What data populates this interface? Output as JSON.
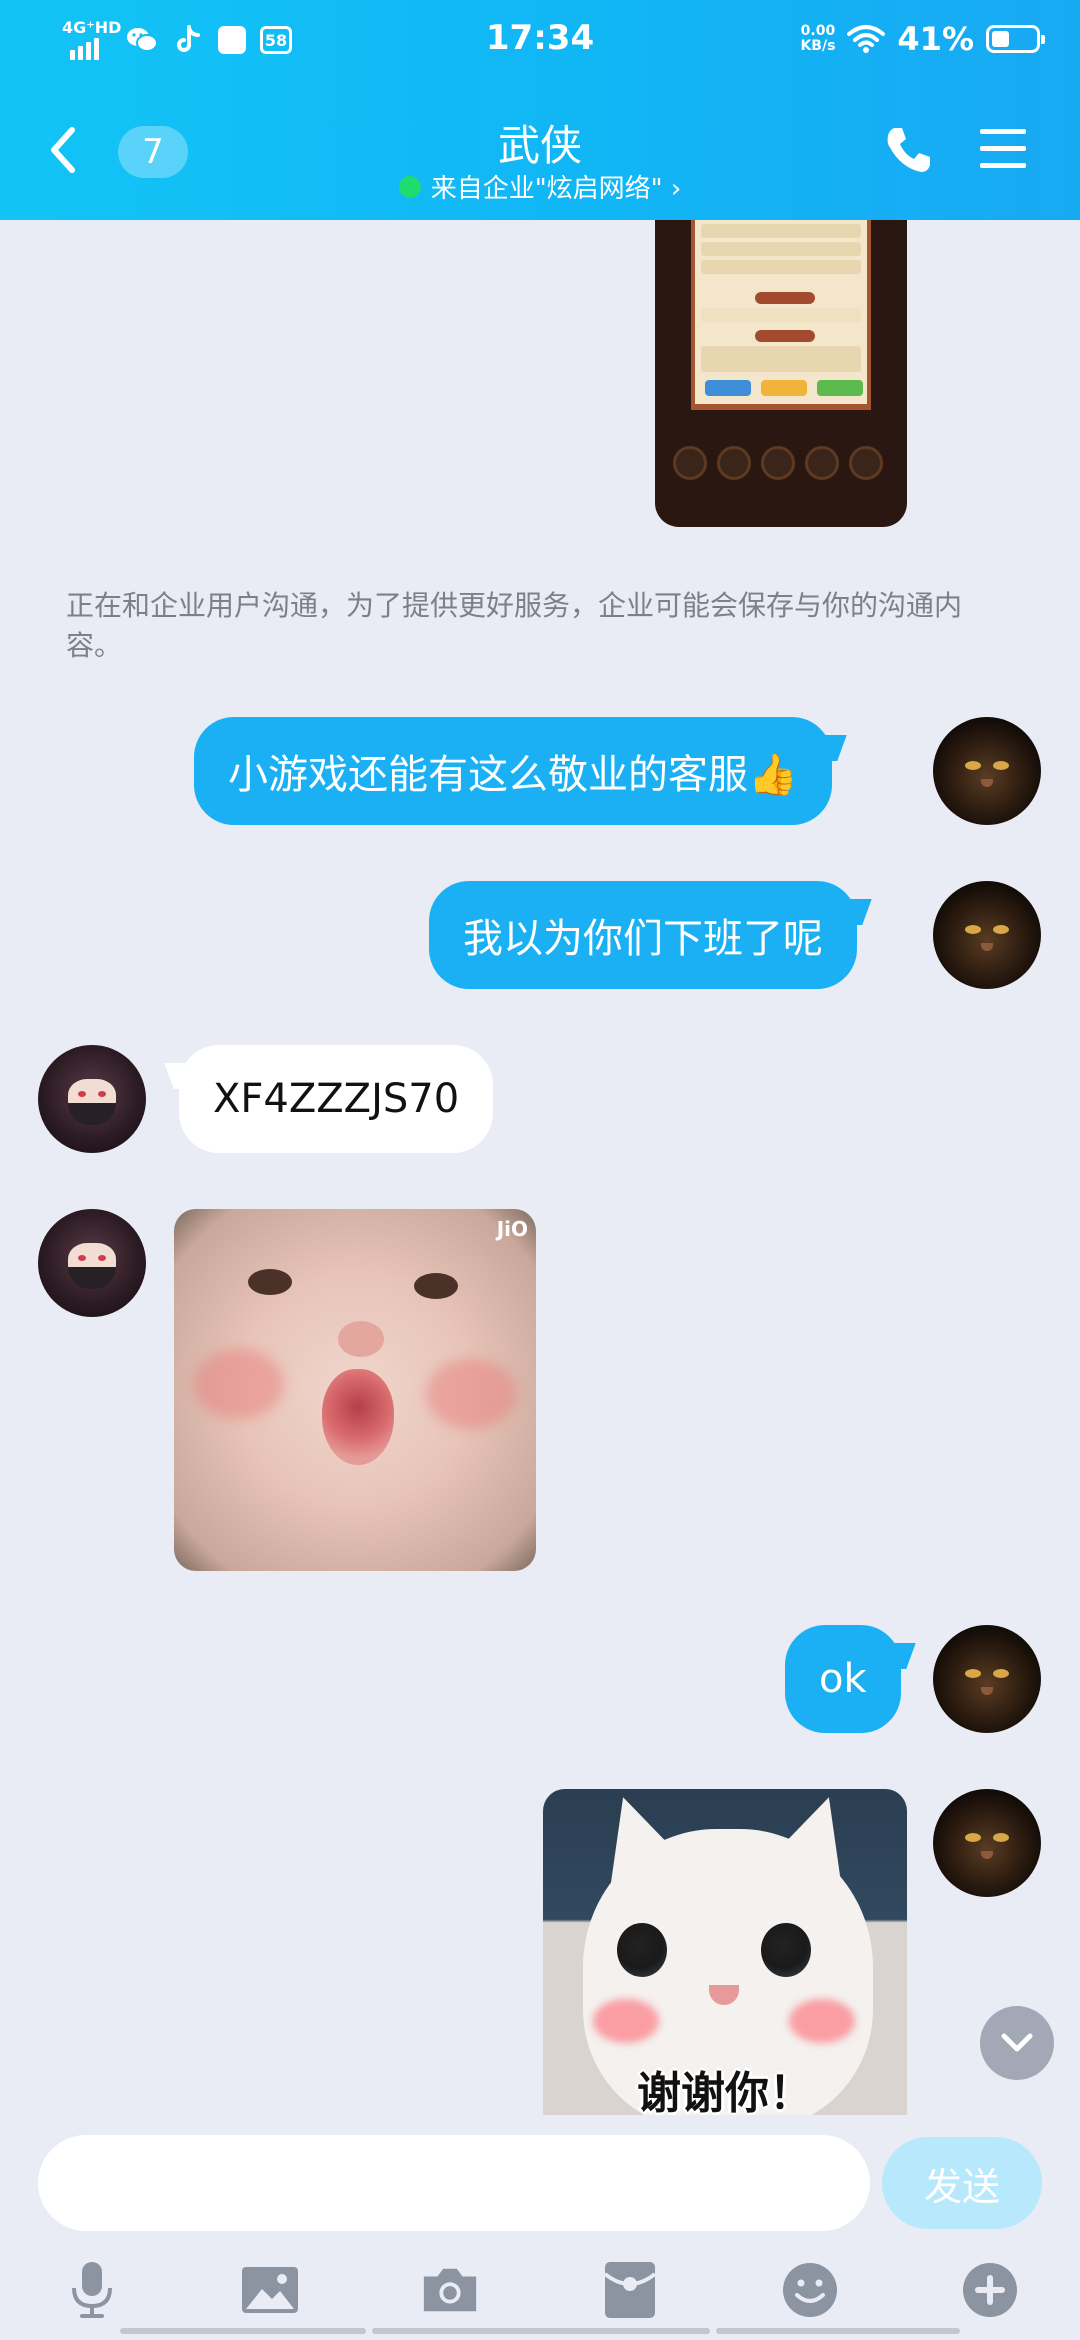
{
  "status_bar": {
    "network": "4G⁺HD",
    "time": "17:34",
    "net_speed_value": "0.00",
    "net_speed_unit": "KB/s",
    "battery_percent": "41%",
    "battery_level": 0.41,
    "app_badge": "58"
  },
  "nav": {
    "unread_count": "7",
    "title": "武侠",
    "subtitle": "来自企业\"炫启网络\" ›"
  },
  "chat": {
    "notice": "正在和企业用户沟通，为了提供更好服务，企业可能会保存与你的沟通内容。",
    "messages": [
      {
        "from": "me",
        "text": "小游戏还能有这么敬业的客服👍"
      },
      {
        "from": "me",
        "text": "我以为你们下班了呢"
      },
      {
        "from": "them",
        "text": "XF4ZZZJS70"
      },
      {
        "from": "them",
        "type": "image",
        "watermark": "JiO"
      },
      {
        "from": "me",
        "text": "ok"
      },
      {
        "from": "me",
        "type": "image",
        "caption": "谢谢你！"
      }
    ]
  },
  "input": {
    "placeholder": "",
    "send_label": "发送"
  },
  "colors": {
    "header": "#12c4f6",
    "bubble_me": "#1bb0f3",
    "bubble_them": "#ffffff",
    "background": "#e9ecf4"
  },
  "icons": [
    "back-icon",
    "phone-icon",
    "menu-icon",
    "chevron-down-icon",
    "microphone-icon",
    "image-icon",
    "camera-icon",
    "red-packet-icon",
    "emoji-icon",
    "plus-icon"
  ]
}
